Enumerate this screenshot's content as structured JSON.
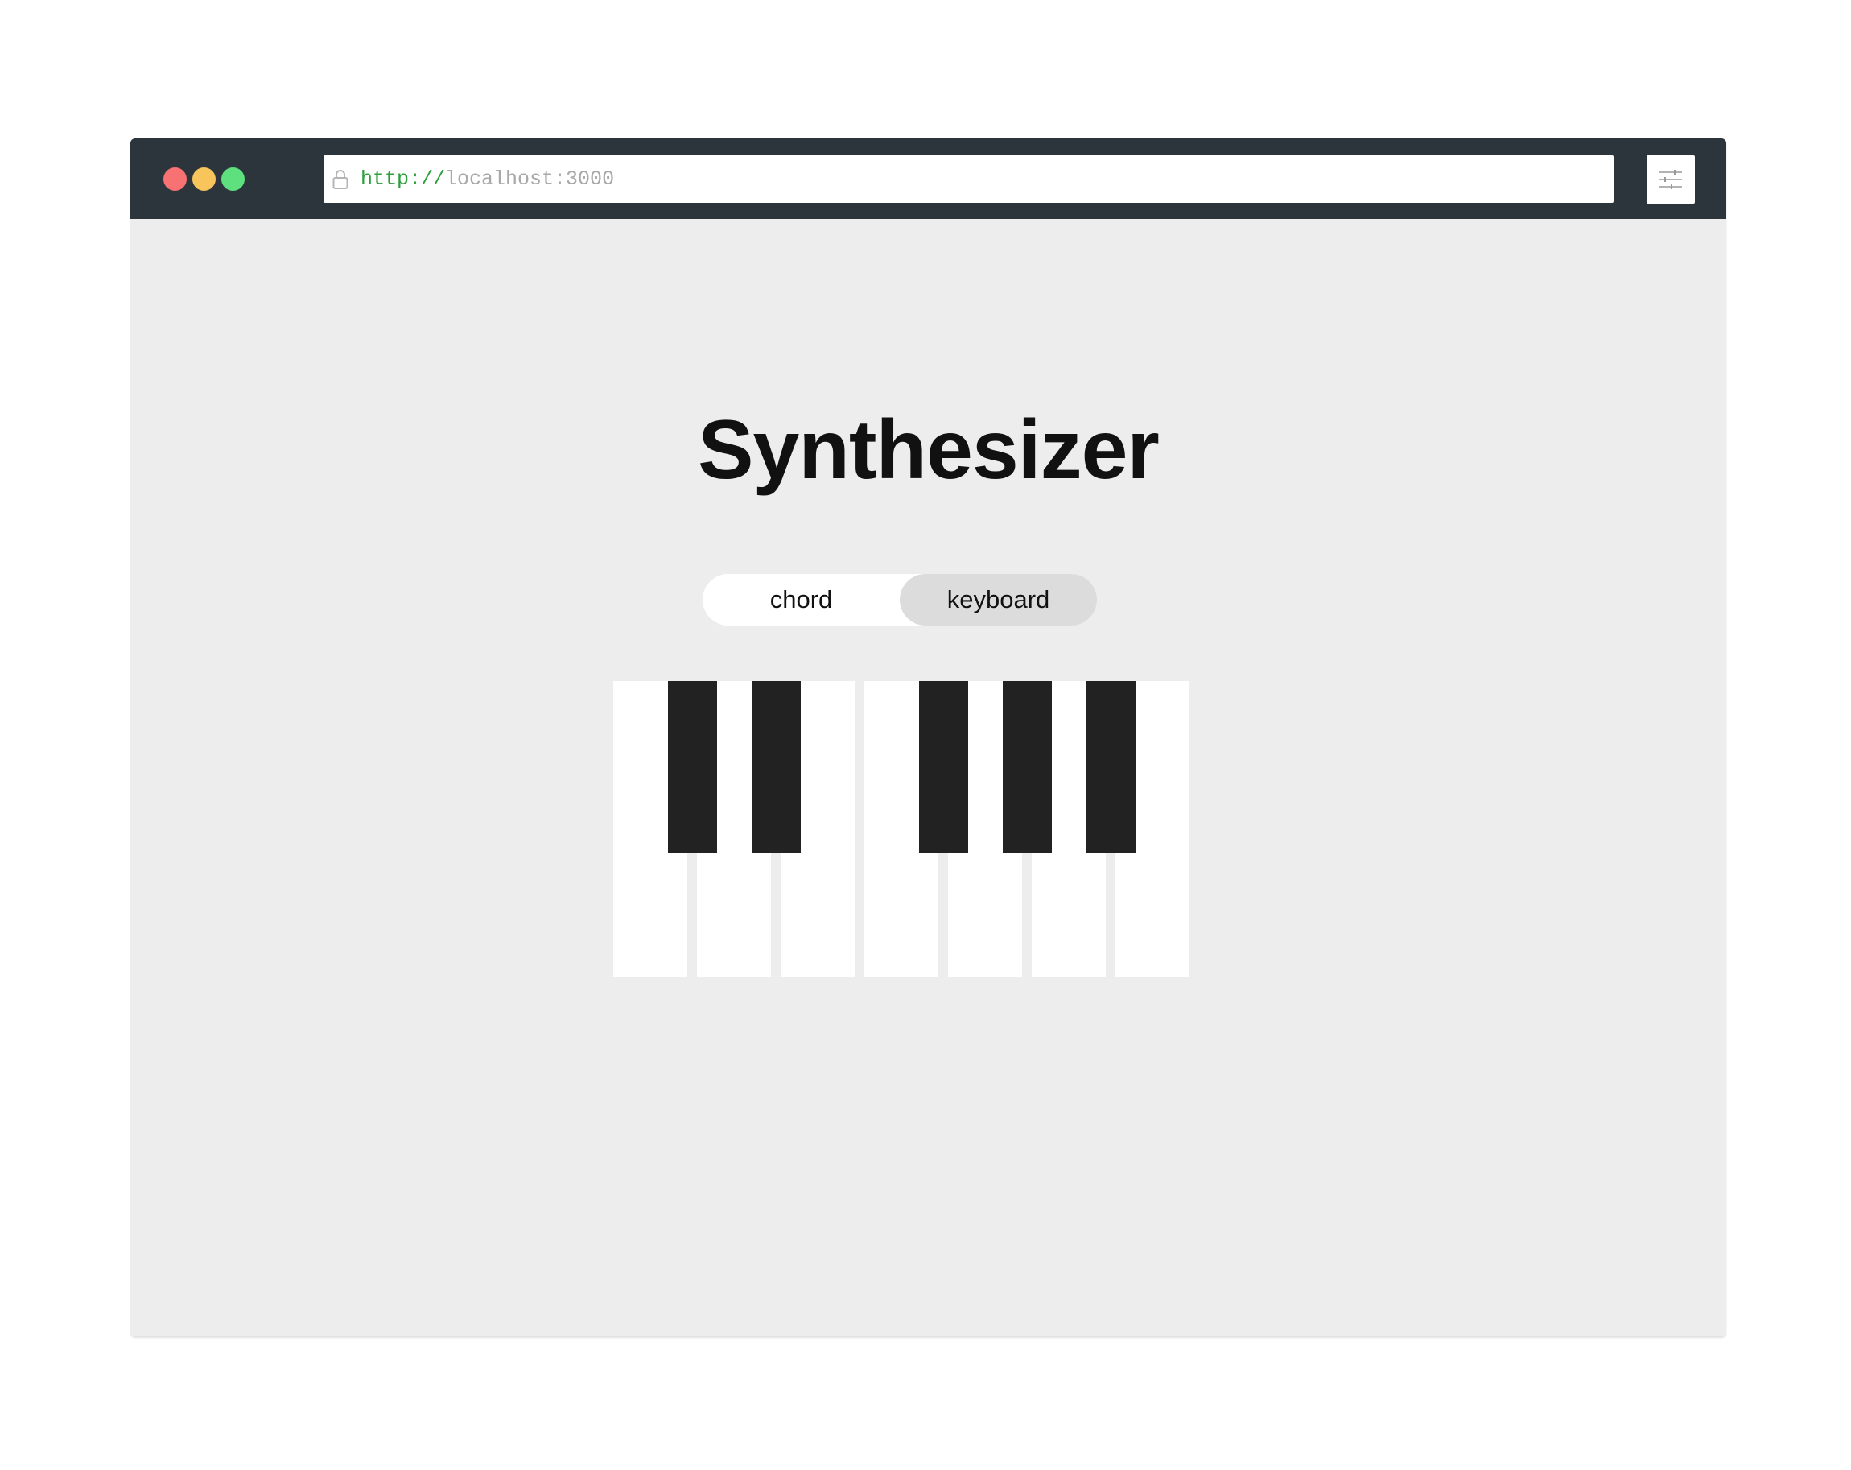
{
  "browser": {
    "traffic_lights": [
      {
        "name": "close",
        "color": "#f87273"
      },
      {
        "name": "minimize",
        "color": "#f7c55c"
      },
      {
        "name": "maximize",
        "color": "#5ee07e"
      }
    ],
    "url_scheme": "http://",
    "url_host": "localhost:3000",
    "settings_icon": "sliders-icon",
    "lock_icon": "lock-icon"
  },
  "page": {
    "title": "Synthesizer"
  },
  "mode_toggle": {
    "options": [
      "chord",
      "keyboard"
    ],
    "selected": "keyboard"
  },
  "keyboard": {
    "white_keys": 7,
    "black_keys": 5,
    "white_color": "#ffffff",
    "black_color": "#222222"
  }
}
